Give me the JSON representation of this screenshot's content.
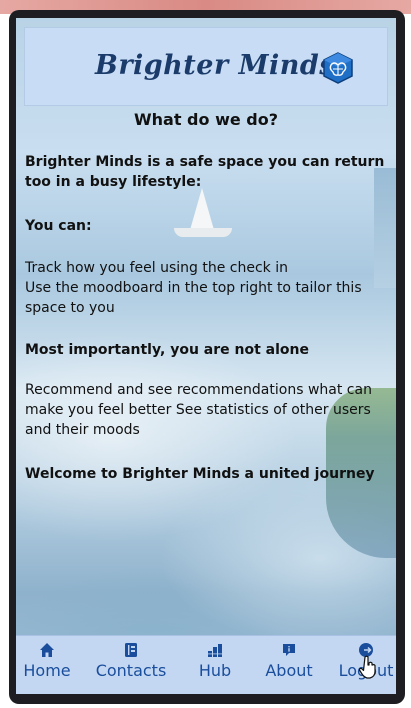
{
  "app": {
    "brand_title": "Brighter Minds",
    "accent_color": "#1a4e9c",
    "header_bg": "#c8ddf5",
    "logo_icon": "brain-cube-icon"
  },
  "content": {
    "heading": "What do we do?",
    "intro": "Brighter Minds is a safe space you can return too in a busy lifestyle:",
    "you_can": "You can:",
    "line_checkin": "Track how you feel using the check in",
    "line_moodboard": "Use the moodboard in the top right to tailor this space to you",
    "not_alone": "Most importantly, you are not alone",
    "recommend": "Recommend and see recommendations what can make you feel better See statistics of other users and their moods",
    "welcome": "Welcome to Brighter Minds a united journey"
  },
  "nav": {
    "items": [
      {
        "label": "Home",
        "icon": "home-icon"
      },
      {
        "label": "Contacts",
        "icon": "contacts-icon"
      },
      {
        "label": "Hub",
        "icon": "hub-icon"
      },
      {
        "label": "About",
        "icon": "about-icon"
      },
      {
        "label": "Logout",
        "icon": "logout-icon"
      }
    ]
  }
}
